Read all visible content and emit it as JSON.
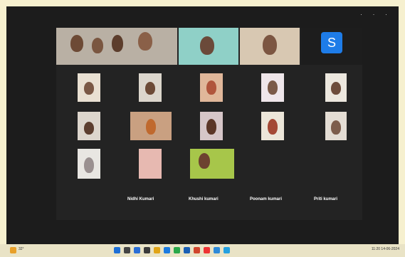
{
  "top_controls": "· · ·",
  "avatar_letter": "S",
  "big_names": [
    "Nidhi Kumari",
    "Khushi kumari",
    "Poonam kumari",
    "Priti kumari"
  ],
  "accent": "#1e7ce8",
  "taskbar": {
    "weather": "32°",
    "clock": "11:20",
    "date": "14-06-2024"
  }
}
